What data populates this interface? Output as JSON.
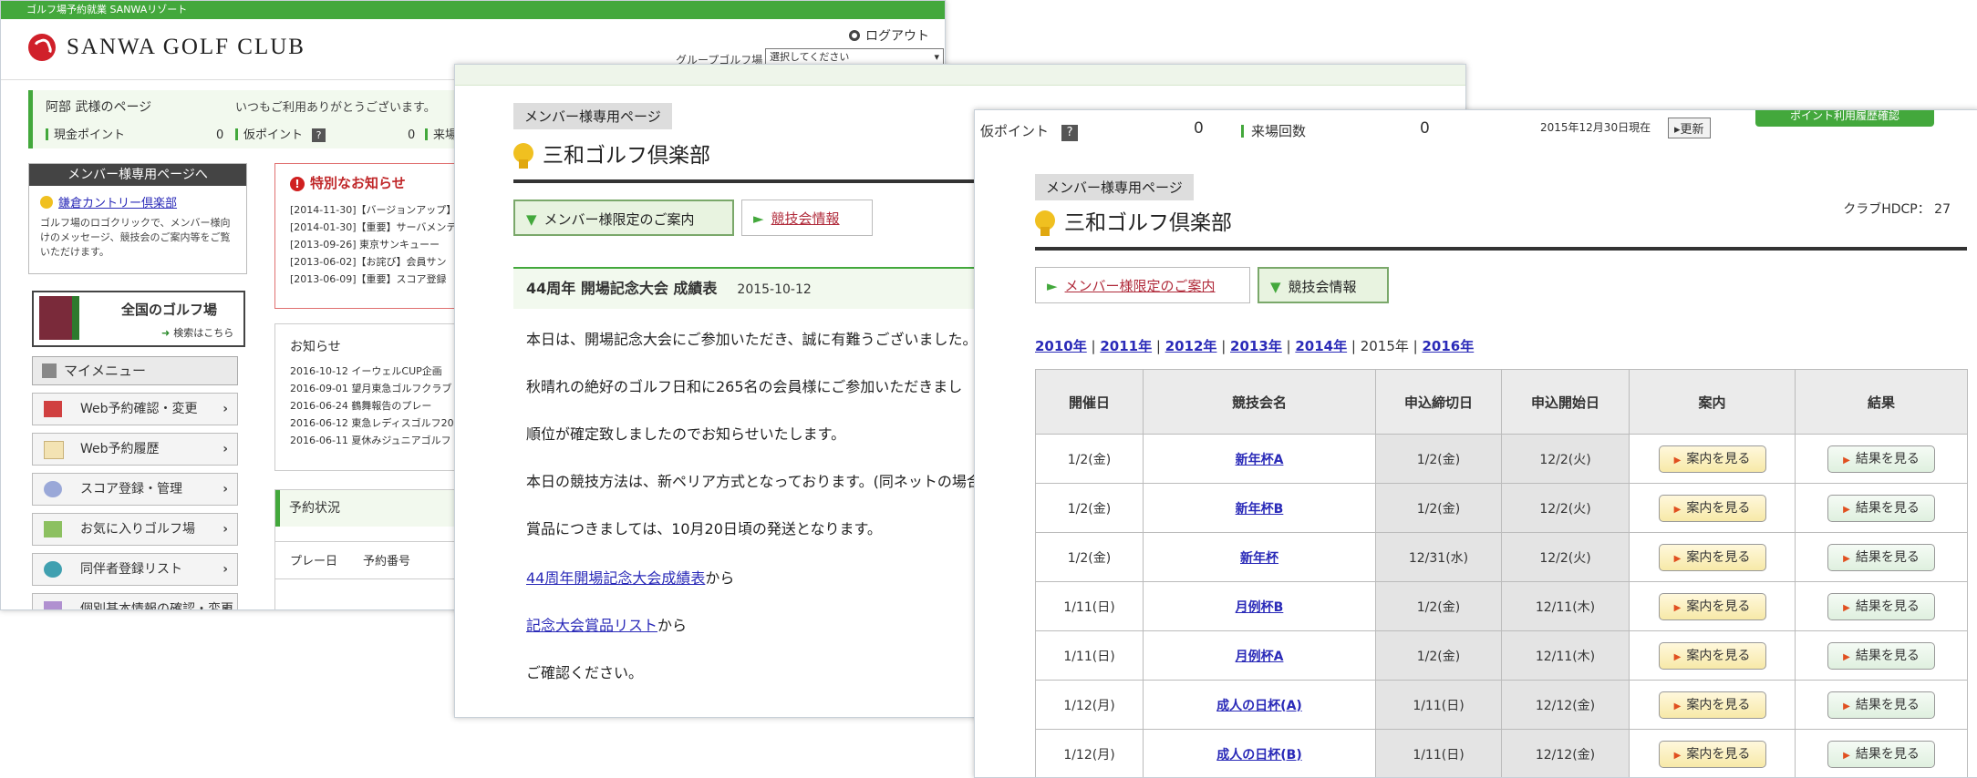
{
  "window1": {
    "top_strip_text": "ゴルフ場予約就業 SANWAリゾート",
    "brand": "SANWA GOLF CLUB",
    "logout_label": "ログアウト",
    "group_label": "グループゴルフ場",
    "group_select": "選択してください",
    "member_name": "阿部 武様のページ",
    "greeting": "いつもご利用ありがとうございます。",
    "points": [
      {
        "label": "現金ポイント",
        "value": "0"
      },
      {
        "label": "仮ポイント",
        "value": "0"
      },
      {
        "label": "来場",
        "value": ""
      }
    ],
    "member_box": {
      "header": "メンバー様専用ページへ",
      "link": "鎌倉カントリー倶楽部",
      "text": "ゴルフ場のロゴクリックで、メンバー様向けのメッセージ、競技会のご案内等をご覧いただけます。"
    },
    "notice": {
      "header": "特別なお知らせ",
      "rows": [
        "[2014-11-30]【バージョンアップ】",
        "[2014-01-30]【重要】サーバメンテ",
        "[2013-09-26] 東京サンキューー",
        "[2013-06-02]【お詫び】会員サン",
        "[2013-06-09]【重要】スコア登録"
      ]
    },
    "golf_banner": {
      "title": "全国のゴルフ場",
      "sub": "検索はこちら"
    },
    "my_menu": {
      "header": "マイメニュー",
      "items": [
        "Web予約確認・変更",
        "Web予約履歴",
        "スコア登録・管理",
        "お気に入りゴルフ場",
        "同伴者登録リスト",
        "個別基本情報の確認・変更"
      ]
    },
    "news": {
      "header": "お知らせ",
      "rows": [
        "2016-10-12 イーウェルCUP企画",
        "2016-09-01 望月東急ゴルフクラブ",
        "2016-06-24 鶴舞報告のプレー",
        "2016-06-12 東急レディスゴルフ20",
        "2016-06-11 夏休みジュニアゴルフ"
      ]
    },
    "reservation": {
      "header": "予約状況",
      "columns": [
        "プレー日",
        "予約番号"
      ]
    }
  },
  "window2": {
    "page_label": "メンバー様専用ページ",
    "club_title": "三和ゴルフ倶楽部",
    "tab_member": "メンバー様限定のご案内",
    "tab_competition": "競技会情報",
    "section_title": "44周年 開場記念大会 成績表",
    "section_date": "2015-10-12",
    "paragraphs": [
      "本日は、開場記念大会にご参加いただき、誠に有難うございました。",
      "秋晴れの絶好のゴルフ日和に265名の会員様にご参加いただきまし",
      "順位が確定致しましたのでお知らせいたします。",
      "本日の競技方法は、新ペリア方式となっております。(同ネットの場合",
      "賞品につきましては、10月20日頃の発送となります。"
    ],
    "link1": "44周年開場記念大会成績表",
    "link1_suffix": "から",
    "link2": "記念大会賞品リスト",
    "link2_suffix": "から",
    "closing": "ご確認ください。"
  },
  "window3": {
    "points_bar": {
      "kari_label": "仮ポイント",
      "kari_value": "0",
      "visits_label": "来場回数",
      "visits_value": "0",
      "as_of": "2015年12月30日現在",
      "update_label": "▸更新",
      "green_button": "ポイント利用履歴確認"
    },
    "page_label": "メンバー様専用ページ",
    "club_title": "三和ゴルフ倶楽部",
    "hdcp": "クラブHDCP： 27",
    "tab_member": "メンバー様限定のご案内",
    "tab_competition": "競技会情報",
    "years": {
      "links": [
        "2010年",
        "2011年",
        "2012年",
        "2013年",
        "2014年"
      ],
      "current": "2015年",
      "next": "2016年"
    },
    "table": {
      "headers": [
        "開催日",
        "競技会名",
        "申込締切日",
        "申込開始日",
        "案内",
        "結果"
      ],
      "guide_label": "案内を見る",
      "result_label": "結果を見る",
      "rows": [
        [
          "1/2(金)",
          "新年杯A",
          "1/2(金)",
          "12/2(火)"
        ],
        [
          "1/2(金)",
          "新年杯B",
          "1/2(金)",
          "12/2(火)"
        ],
        [
          "1/2(金)",
          "新年杯",
          "12/31(水)",
          "12/2(火)"
        ],
        [
          "1/11(日)",
          "月例杯B",
          "1/2(金)",
          "12/11(木)"
        ],
        [
          "1/11(日)",
          "月例杯A",
          "1/2(金)",
          "12/11(木)"
        ],
        [
          "1/12(月)",
          "成人の日杯(A)",
          "1/11(日)",
          "12/12(金)"
        ],
        [
          "1/12(月)",
          "成人の日杯(B)",
          "1/11(日)",
          "12/12(金)"
        ]
      ]
    }
  },
  "colors": {
    "accent_green": "#43a83c",
    "brand_red": "#d0202a",
    "notice_red": "#c0282a",
    "link_blue": "#2a2ab8"
  }
}
